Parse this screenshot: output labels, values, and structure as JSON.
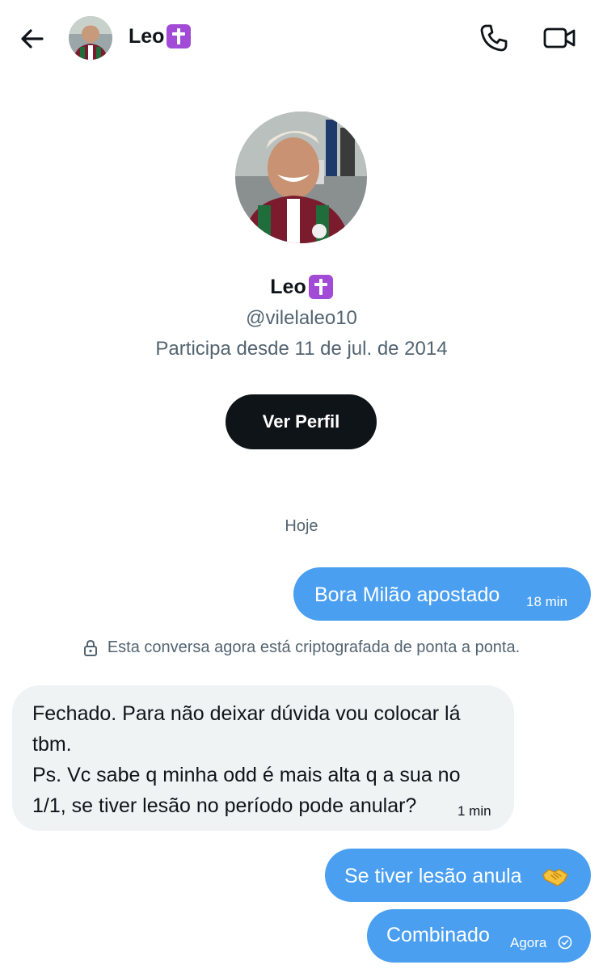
{
  "header": {
    "name": "Leo",
    "name_badge_icon": "latin-cross-emoji",
    "back_icon": "back-arrow-icon",
    "call_icon": "phone-icon",
    "video_icon": "video-camera-icon"
  },
  "profile": {
    "name": "Leo",
    "handle": "@vilelaleo10",
    "joined": "Participa desde 11 de jul. de 2014",
    "view_profile_label": "Ver Perfil"
  },
  "conversation": {
    "date_separator": "Hoje",
    "encryption_notice": "Esta conversa agora está criptografada de ponta a ponta.",
    "messages": [
      {
        "direction": "outgoing",
        "text": "Bora Milão apostado",
        "time": "18 min"
      },
      {
        "direction": "incoming",
        "lines": [
          "Fechado. Para não deixar dúvida vou colocar lá",
          "tbm.",
          "Ps. Vc sabe q minha odd é mais alta q a sua no",
          "1/1, se tiver lesão no período pode anular?"
        ],
        "time": "1 min"
      },
      {
        "direction": "outgoing",
        "text": "Se tiver lesão anula",
        "emoji": "handshake-emoji"
      },
      {
        "direction": "outgoing",
        "text": "Combinado",
        "time": "Agora",
        "status_icon": "sent-check-icon"
      }
    ]
  },
  "colors": {
    "outgoing_bubble": "#4a9ff0",
    "incoming_bubble": "#eff3f4",
    "primary_button": "#0f1419",
    "secondary_text": "#536471",
    "badge_purple": "#a24bd6"
  }
}
